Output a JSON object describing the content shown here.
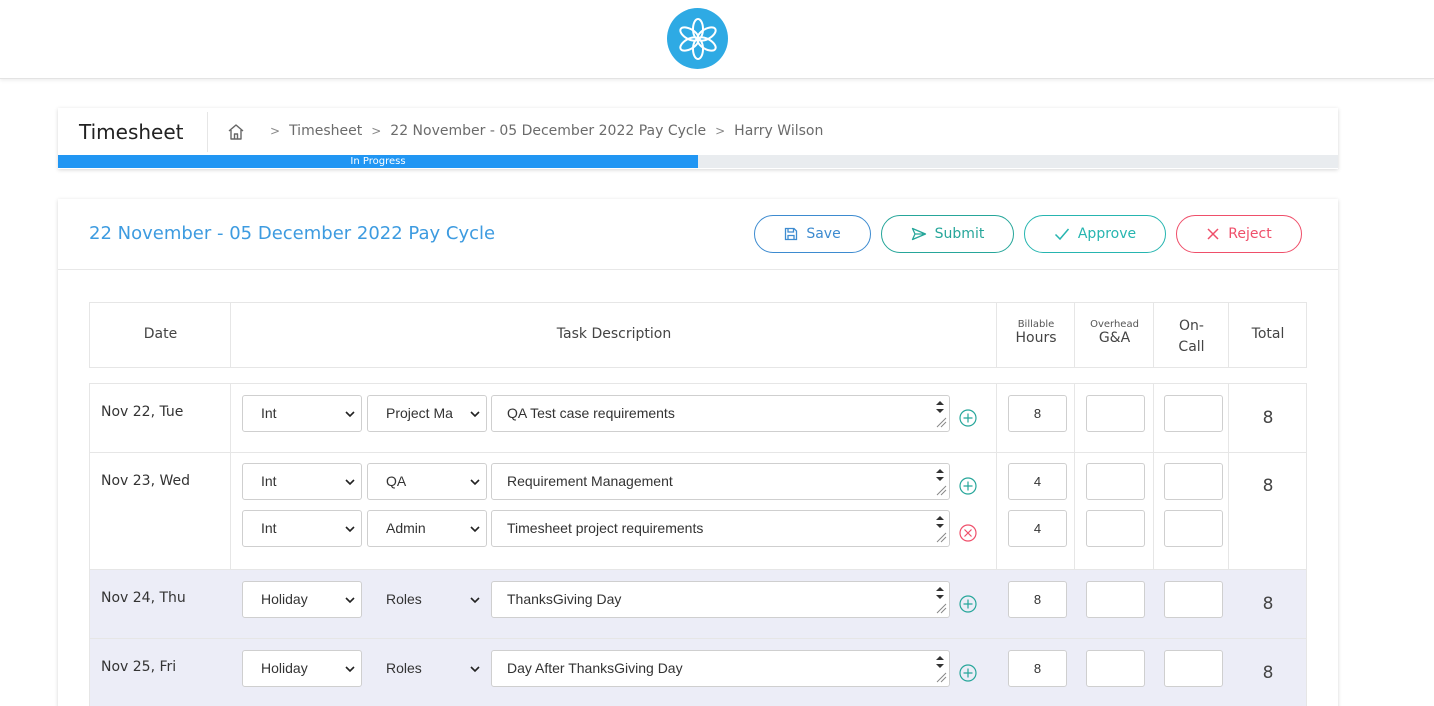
{
  "breadcrumb": {
    "title": "Timesheet",
    "items": [
      "Timesheet",
      "22 November - 05 December 2022 Pay Cycle",
      "Harry Wilson"
    ],
    "progress_label": "In Progress",
    "progress_fraction": 0.5
  },
  "card": {
    "title": "22 November - 05 December 2022 Pay Cycle",
    "buttons": {
      "save": "Save",
      "submit": "Submit",
      "approve": "Approve",
      "reject": "Reject"
    }
  },
  "table": {
    "headers": {
      "date": "Date",
      "task": "Task Description",
      "billable_small": "Billable",
      "billable": "Hours",
      "overhead_small": "Overhead",
      "overhead": "G&A",
      "oncall_1": "On-",
      "oncall_2": "Call",
      "total": "Total"
    },
    "rows": [
      {
        "date": "Nov 22, Tue",
        "total": "8",
        "entries": [
          {
            "type": "Int",
            "category": "Project Ma",
            "task": "QA Test case requirements",
            "hours": "8",
            "action": "add"
          }
        ]
      },
      {
        "date": "Nov 23, Wed",
        "total": "8",
        "entries": [
          {
            "type": "Int",
            "category": "QA",
            "task": "Requirement Management",
            "hours": "4",
            "action": "add"
          },
          {
            "type": "Int",
            "category": "Admin",
            "task": "Timesheet project requirements",
            "hours": "4",
            "action": "remove"
          }
        ]
      },
      {
        "date": "Nov 24, Thu",
        "total": "8",
        "entries": [
          {
            "type": "Holiday",
            "category": "Roles",
            "task": "ThanksGiving Day",
            "hours": "8",
            "action": "add"
          }
        ]
      },
      {
        "date": "Nov 25, Fri",
        "total": "8",
        "entries": [
          {
            "type": "Holiday",
            "category": "Roles",
            "task": "Day After ThanksGiving Day",
            "hours": "8",
            "action": "add"
          }
        ]
      }
    ]
  },
  "colors": {
    "primary": "#2196f3",
    "title": "#3d9be0",
    "save": "#3d8bd0",
    "submit": "#26a69a",
    "approve": "#26b5b0",
    "reject": "#ef4f6a"
  },
  "icons": {
    "logo": "flower-logo-icon",
    "home": "home-icon",
    "save": "floppy-icon",
    "submit": "send-icon",
    "approve": "check-icon",
    "reject": "x-icon",
    "add": "plus-circle-icon",
    "remove": "x-circle-icon"
  }
}
